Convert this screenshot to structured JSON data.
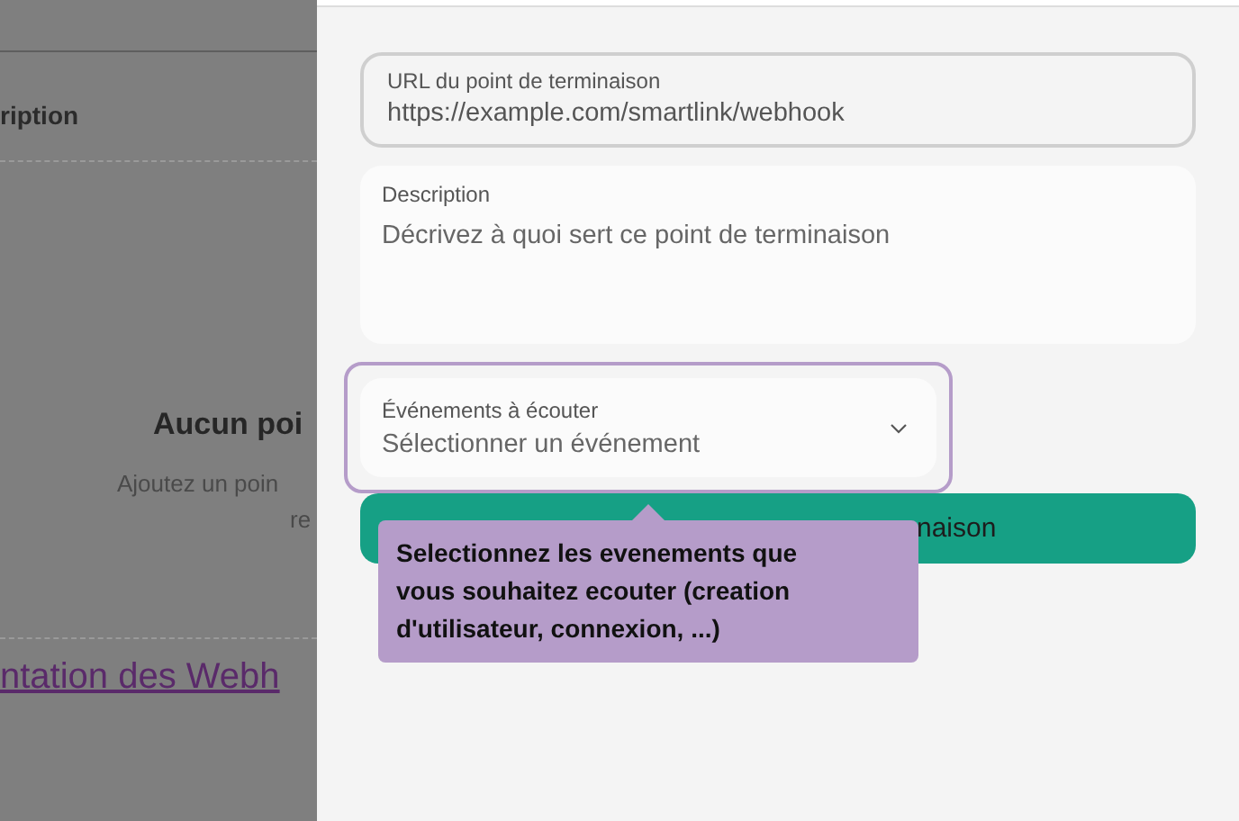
{
  "backdrop": {
    "column_heading": "ription",
    "empty_title": "Aucun poi",
    "empty_text_lines": [
      "Ajoutez un poin",
      "re"
    ],
    "docs_link": "ntation des Webh"
  },
  "form": {
    "url_field": {
      "label": "URL du point de terminaison",
      "value": "https://example.com/smartlink/webhook"
    },
    "description_field": {
      "label": "Description",
      "placeholder": "Décrivez à quoi sert ce point de terminaison"
    },
    "events_select": {
      "label": "Événements à écouter",
      "placeholder": "Sélectionner un événement",
      "highlighted": true
    },
    "submit_button": {
      "label": "naison"
    }
  },
  "tooltip": {
    "text": "Selectionnez les evenements que vous souhaitez ecouter (creation d'utilisateur, connexion, ...)"
  }
}
